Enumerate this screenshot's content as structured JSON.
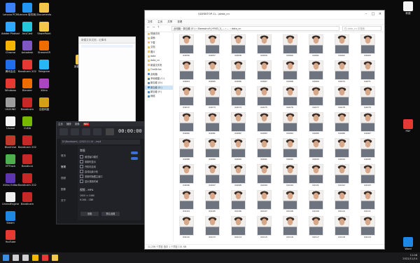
{
  "desktop": {
    "left_icons": [
      {
        "label": "Lenovo PCM",
        "color": "#3b82f6"
      },
      {
        "label": "Adobe Photoshop",
        "color": "#31a8ff"
      },
      {
        "label": "Chrome",
        "color": "#f4b400"
      },
      {
        "label": "腾讯会议",
        "color": "#1f6feb"
      },
      {
        "label": "Windows",
        "color": "#e53935"
      },
      {
        "label": "UNIGINE",
        "color": "#9e9e9e"
      },
      {
        "label": "Unreal",
        "color": "#f5f5f5"
      },
      {
        "label": "BlackVue",
        "color": "#c0392b"
      },
      {
        "label": "HTTrack",
        "color": "#4caf50"
      },
      {
        "label": "Xilinx Editor",
        "color": "#5e35b1"
      },
      {
        "label": "UnrealEngine",
        "color": "#eeeeee"
      },
      {
        "label": "Steam",
        "color": "#1e88e5"
      },
      {
        "label": "YouTube",
        "color": "#e53935"
      }
    ],
    "col2_icons": [
      {
        "label": "Lenovo 软件商店",
        "color": "#2196f3"
      },
      {
        "label": "AnyCast",
        "color": "#26c6da"
      },
      {
        "label": "Autodesk",
        "color": "#7e57c2"
      },
      {
        "label": "Bandicam 2022.11",
        "color": "#e53935"
      },
      {
        "label": "Blender",
        "color": "#ef6c00"
      },
      {
        "label": "Bandicam",
        "color": "#c62828"
      },
      {
        "label": "CUDA",
        "color": "#76b900"
      },
      {
        "label": "Bandicam 2022.11",
        "color": "#c62828"
      },
      {
        "label": "Bandicut",
        "color": "#c62828"
      },
      {
        "label": "Bandicam 2022.11",
        "color": "#c62828"
      },
      {
        "label": "Bandicam",
        "color": "#c62828"
      }
    ],
    "col3_icons": [
      {
        "label": "Documents",
        "color": "#f2c54b"
      },
      {
        "label": "SharePoint",
        "color": "#f2c54b"
      },
      {
        "label": "StreamVR",
        "color": "#ef6c00"
      },
      {
        "label": "Telegram",
        "color": "#29b6f6"
      },
      {
        "label": "Xilinx",
        "color": "#ab47bc"
      },
      {
        "label": "百度网盘",
        "color": "#d4a017"
      }
    ],
    "folder_icon": {
      "label": "新建文件夹",
      "color": "#f2c54b"
    },
    "right_icons": [
      {
        "label": "新建",
        "color": "#f5f5f5"
      },
      {
        "label": "PDF",
        "color": "#e53935"
      },
      {
        "label": "Word",
        "color": "#1e88e5"
      }
    ]
  },
  "note_window": {
    "title": "新建文本文档 - 记事本"
  },
  "recorder": {
    "tabs": [
      "主页",
      "捕获",
      "录像",
      "REC"
    ],
    "timer": "00:00:00",
    "path": "D:\\Bandicam\\...\\2022-11-14 ...mp4",
    "sidebar": [
      "首页",
      "常规",
      "视频",
      "图像",
      "关于"
    ],
    "panel_title": "常规",
    "options": [
      "置顶窗口模式",
      "录制时显示",
      "开机时启动",
      "启动后最小化",
      "录制时隐藏主窗口",
      "显示录制时间"
    ],
    "format_title": "视频 - MP4",
    "spec1": "1920 × 1080",
    "spec2": "H.264 - CBR",
    "button_settings": "设置",
    "button_defaults": "默认设置"
  },
  "explorer": {
    "title": "\\\\DESKTOP-1\\...\\data_cn",
    "ribbon": [
      "文件",
      "主页",
      "共享",
      "查看"
    ],
    "path_segments": "此电脑 › 新加卷 (E:) › StereoInv9_HYVD_3_... › ... › data_cn",
    "search_placeholder": "在 data_cn 中搜索",
    "nav": [
      {
        "label": "快速访问",
        "type": "folder"
      },
      {
        "label": "桌面",
        "type": "folder"
      },
      {
        "label": "下载",
        "type": "folder"
      },
      {
        "label": "文档",
        "type": "folder"
      },
      {
        "label": "图片",
        "type": "folder"
      },
      {
        "label": "data",
        "type": "folder"
      },
      {
        "label": "data_cn",
        "type": "folder"
      },
      {
        "label": "新建文件夹",
        "type": "folder"
      },
      {
        "label": "OneDrive",
        "type": "folder"
      },
      {
        "label": "此电脑",
        "type": "pc"
      },
      {
        "label": "本地磁盘 (C:)",
        "type": "pc"
      },
      {
        "label": "新加卷 (D:)",
        "type": "pc"
      },
      {
        "label": "新加卷 (E:)",
        "type": "pc",
        "selected": true
      },
      {
        "label": "新加卷 (F:)",
        "type": "pc"
      },
      {
        "label": "网络",
        "type": "pc"
      }
    ],
    "thumbnails": [
      "04056",
      "04057",
      "04058",
      "04059",
      "04060",
      "04061",
      "04062",
      "04063",
      "04064",
      "04065",
      "04066",
      "04067",
      "04068",
      "04069",
      "04070",
      "04071",
      "04072",
      "04073",
      "04074",
      "04075",
      "04076",
      "04077",
      "04078",
      "04079",
      "04080",
      "04081",
      "04082",
      "04083",
      "04084",
      "04085",
      "04086",
      "04087",
      "04088",
      "04089",
      "04090",
      "04091",
      "04092",
      "04093",
      "04094",
      "04095",
      "04096",
      "04097",
      "04098",
      "04099",
      "04100",
      "04101",
      "04102",
      "04103",
      "04104",
      "04105",
      "04106",
      "04107",
      "04108",
      "04109",
      "04110",
      "04111",
      "04112",
      "04113",
      "04114",
      "04115",
      "04116",
      "04117",
      "04118",
      "04119"
    ],
    "status": "11,236 个项目   选中 1 个项目 151 KB"
  },
  "taskbar": {
    "icons": [
      {
        "name": "windows-start-icon",
        "color": "#3a8ee6"
      },
      {
        "name": "search-icon",
        "color": "#cfcfcf"
      },
      {
        "name": "task-view-icon",
        "color": "#cfcfcf"
      },
      {
        "name": "chrome-icon",
        "color": "#f4b400"
      },
      {
        "name": "bandicam-icon",
        "color": "#e53935"
      },
      {
        "name": "explorer-icon",
        "color": "#f2c54b"
      }
    ],
    "time": "11:08",
    "date": "2022/11/14"
  }
}
